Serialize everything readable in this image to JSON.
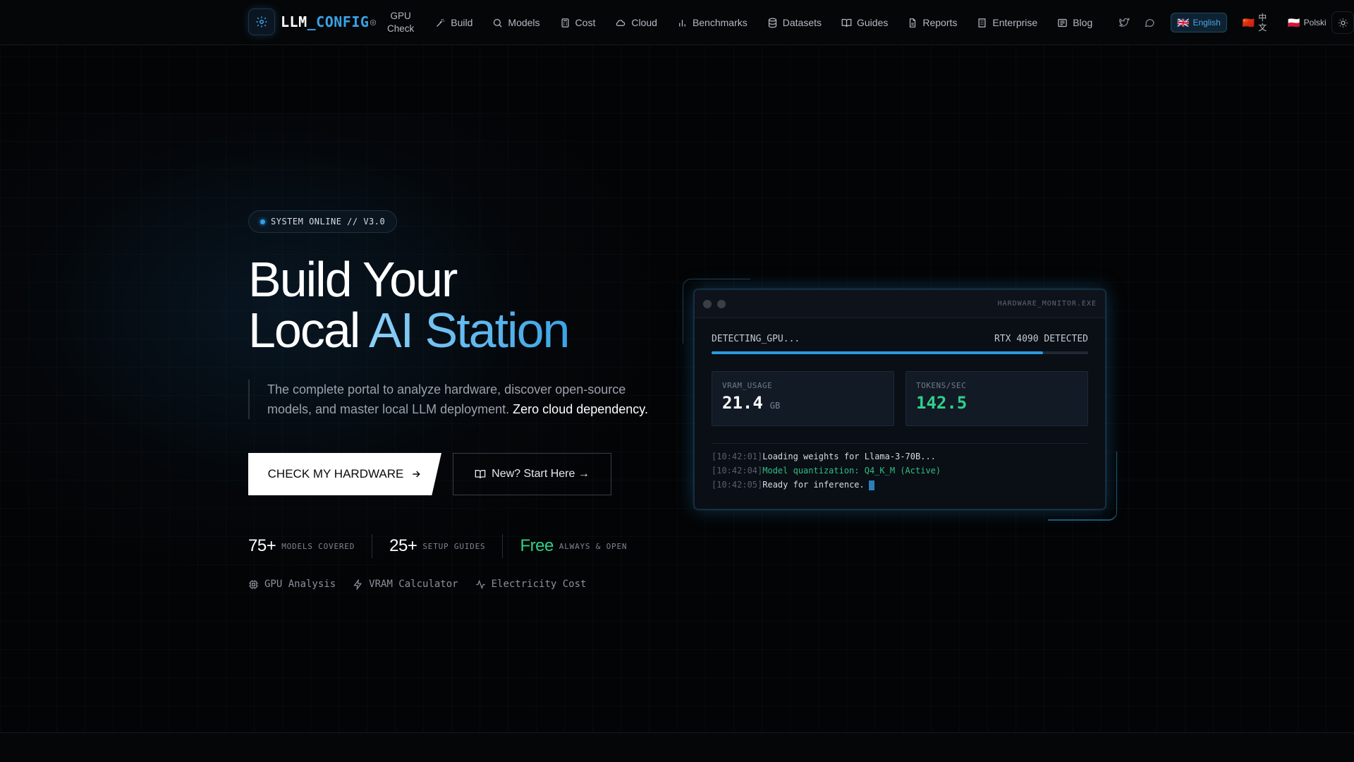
{
  "nav": {
    "brand_prefix": "LLM",
    "brand_suffix": "_CONFIG",
    "gpu_check_line1": "GPU",
    "gpu_check_line2": "Check",
    "items": [
      {
        "label": "Build",
        "icon": "wand-icon"
      },
      {
        "label": "Models",
        "icon": "search-icon"
      },
      {
        "label": "Cost",
        "icon": "calculator-icon"
      },
      {
        "label": "Cloud",
        "icon": "cloud-icon"
      },
      {
        "label": "Benchmarks",
        "icon": "bar-chart-icon"
      },
      {
        "label": "Datasets",
        "icon": "database-icon"
      },
      {
        "label": "Guides",
        "icon": "book-icon"
      },
      {
        "label": "Reports",
        "icon": "file-icon"
      },
      {
        "label": "Enterprise",
        "icon": "building-icon"
      },
      {
        "label": "Blog",
        "icon": "newspaper-icon"
      }
    ],
    "languages": [
      {
        "flag": "🇬🇧",
        "label": "English",
        "active": true
      },
      {
        "flag": "🇨🇳",
        "label": "中文",
        "active": false
      },
      {
        "flag": "🇵🇱",
        "label": "Polski",
        "active": false
      }
    ]
  },
  "hero": {
    "badge": "SYSTEM ONLINE // V3.0",
    "title_line1": "Build Your",
    "title_line2_plain": "Local ",
    "title_line2_accent": "AI Station",
    "description": "The complete portal to analyze hardware, discover open-source models, and master local LLM deployment. ",
    "description_highlight": "Zero cloud dependency.",
    "primary_button": "CHECK MY HARDWARE",
    "secondary_button": "New? Start Here →",
    "stats": [
      {
        "value": "75+",
        "label": "MODELS COVERED"
      },
      {
        "value": "25+",
        "label": "SETUP GUIDES"
      },
      {
        "value": "Free",
        "label": "ALWAYS & OPEN"
      }
    ],
    "features": [
      {
        "label": "GPU Analysis",
        "icon": "cpu-icon"
      },
      {
        "label": "VRAM Calculator",
        "icon": "lightning-icon"
      },
      {
        "label": "Electricity Cost",
        "icon": "activity-icon"
      }
    ]
  },
  "monitor": {
    "window_title": "HARDWARE_MONITOR.EXE",
    "status_left": "DETECTING_GPU...",
    "status_right": "RTX 4090 DETECTED",
    "progress": 0.88,
    "vram_label": "VRAM_USAGE",
    "vram_value": "21.4",
    "vram_unit": "GB",
    "tps_label": "TOKENS/SEC",
    "tps_value": "142.5",
    "log": [
      {
        "time": "[10:42:01]",
        "text": "Loading weights for Llama-3-70B..."
      },
      {
        "time": "[10:42:04]",
        "text": "Model quantization: Q4_K_M (Active)"
      },
      {
        "time": "[10:42:05]",
        "text": "Ready for inference."
      }
    ]
  },
  "colors": {
    "accent": "#39a3e8",
    "green": "#2fd08a",
    "background": "#030405"
  }
}
